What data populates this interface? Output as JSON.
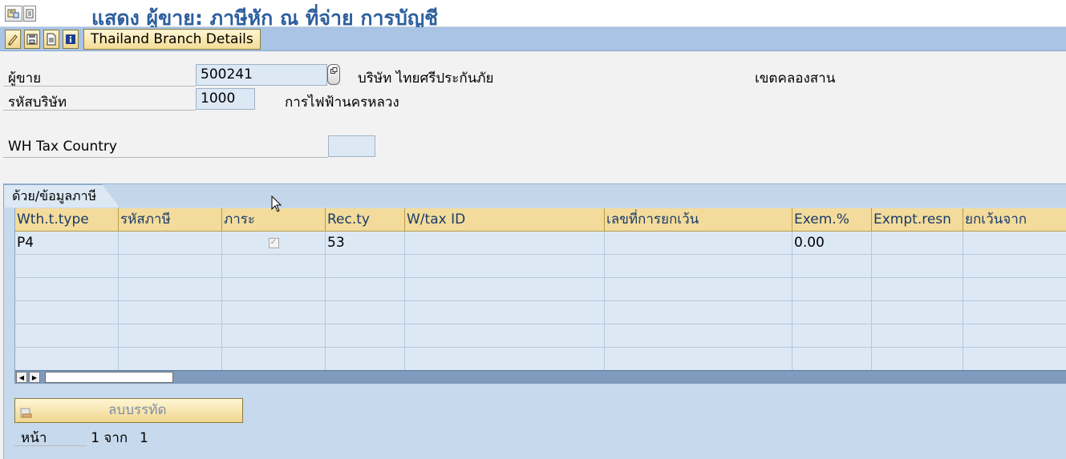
{
  "window": {
    "title": "แสดง ผู้ขาย: ภาษีหัก ณ ที่จ่าย การบัญชี"
  },
  "toolbar": {
    "branch_button_label": "Thailand Branch Details"
  },
  "header": {
    "vendor_label": "ผู้ขาย",
    "vendor_value": "500241",
    "vendor_name": "บริษัท ไทยศรีประกันภัย",
    "vendor_city": "เขตคลองสาน",
    "company_code_label": "รหัสบริษัท",
    "company_code_value": "1000",
    "company_name": "การไฟฟ้านครหลวง",
    "wh_tax_country_label": "WH Tax Country",
    "wh_tax_country_value": ""
  },
  "tab": {
    "label": "ด้วย/ข้อมูลภาษี"
  },
  "table": {
    "columns": [
      "Wth.t.type",
      "รหัสภาษี",
      "ภาระ",
      "Rec.ty",
      "W/tax ID",
      "เลขที่การยกเว้น",
      "Exem.%",
      "Exmpt.resn",
      "ยกเว้นจาก"
    ],
    "rows": [
      {
        "wth_type": "P4",
        "tax_code": "",
        "liable": true,
        "rec_type": "53",
        "wtax_id": "",
        "exemption_no": "",
        "exem_pct": "0.00",
        "exempt_reason": "",
        "exempt_from": ""
      }
    ],
    "empty_rows": 5
  },
  "footer": {
    "delete_row_label": "ลบบรรทัด",
    "page_label": "หน้า",
    "page_current": "1",
    "page_of": "จาก",
    "page_total": "1"
  },
  "colors": {
    "title": "#2d5f9e",
    "toolbar": "#a9c4e4",
    "header_row": "#f3dc9b",
    "cell_bg": "#dde8f5"
  },
  "icons": [
    "favorites-icon",
    "system-menu-icon",
    "edit-icon",
    "save-icon",
    "document-icon",
    "info-icon",
    "f4-help-icon",
    "delete-row-icon",
    "mouse-cursor-icon"
  ]
}
